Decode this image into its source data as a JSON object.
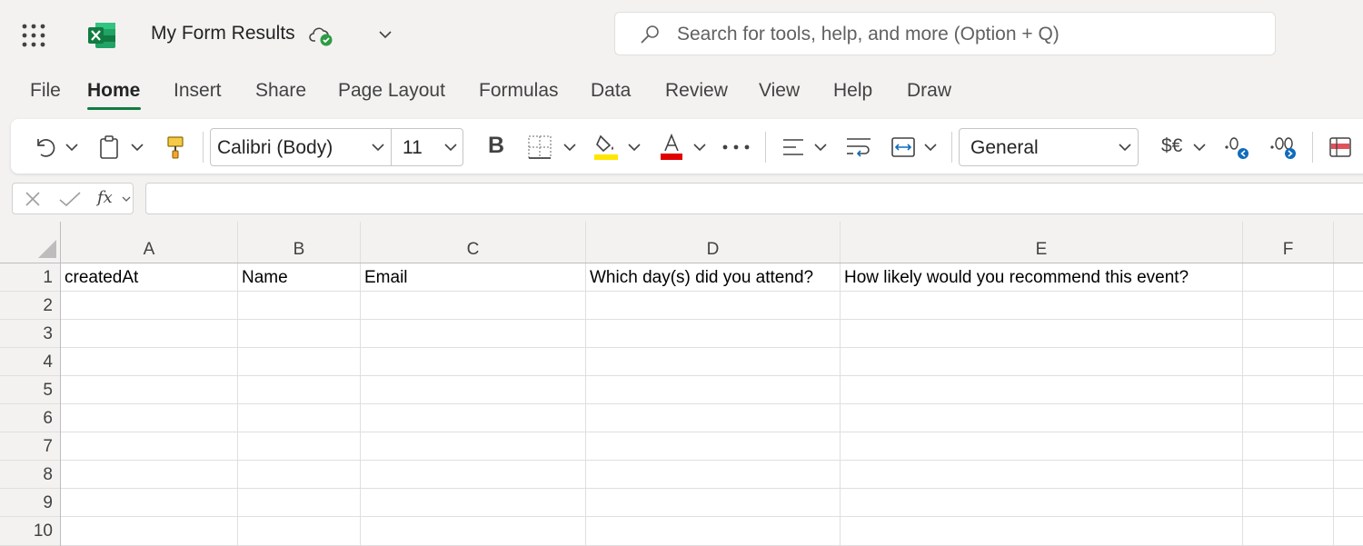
{
  "app": {
    "doc_title": "My Form Results",
    "search_placeholder": "Search for tools, help, and more (Option + Q)",
    "brand_color": "#107c41"
  },
  "tabs": [
    {
      "label": "File",
      "active": false
    },
    {
      "label": "Home",
      "active": true
    },
    {
      "label": "Insert",
      "active": false
    },
    {
      "label": "Share",
      "active": false
    },
    {
      "label": "Page Layout",
      "active": false
    },
    {
      "label": "Formulas",
      "active": false
    },
    {
      "label": "Data",
      "active": false
    },
    {
      "label": "Review",
      "active": false
    },
    {
      "label": "View",
      "active": false
    },
    {
      "label": "Help",
      "active": false
    },
    {
      "label": "Draw",
      "active": false
    }
  ],
  "ribbon": {
    "font_name": "Calibri (Body)",
    "font_size": "11",
    "number_format": "General",
    "bold_label": "B",
    "currency_label": "$€",
    "fill_color": "#ffe600",
    "font_color": "#e00000"
  },
  "formula_bar": {
    "fx_label": "fx",
    "value": ""
  },
  "sheet": {
    "columns": [
      "A",
      "B",
      "C",
      "D",
      "E",
      "F"
    ],
    "rows": [
      "1",
      "2",
      "3",
      "4",
      "5",
      "6",
      "7",
      "8",
      "9",
      "10"
    ],
    "header_row": [
      "createdAt",
      "Name",
      "Email",
      "Which day(s) did you attend?",
      "How likely would you recommend this event?",
      ""
    ]
  }
}
